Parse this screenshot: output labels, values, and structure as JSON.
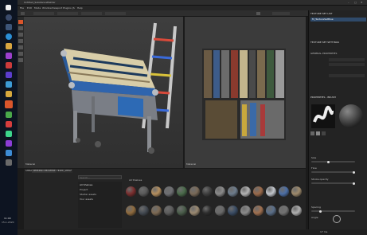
{
  "window": {
    "title": "Untitled_SubstancePainter"
  },
  "menu": [
    "File",
    "Edit",
    "Mode",
    "Window",
    "Viewport",
    "Plugins",
    "JS",
    "Help"
  ],
  "viewport_3d": {
    "label": "Material"
  },
  "viewport_2d": {
    "label": "Material"
  },
  "shelf": {
    "title": "SHELF",
    "tabs": [
      "SPMKRSD MEAMHREL",
      "TEXPE_SHELF"
    ],
    "search_placeholder": "Search...",
    "filter_label": "All Shelves",
    "categories": [
      "All Shelves",
      "Project",
      "Starter assets",
      "Your assets"
    ]
  },
  "materials": [
    {
      "color": "#7a2e2e"
    },
    {
      "color": "#5a5a5a"
    },
    {
      "color": "#b58f5e"
    },
    {
      "color": "#6e6f73"
    },
    {
      "color": "#4a6a4a"
    },
    {
      "color": "#7a6a58"
    },
    {
      "color": "#3f3f3f"
    },
    {
      "color": "#8a8a8a"
    },
    {
      "color": "#6d7c8c"
    },
    {
      "color": "#b4b4b4"
    },
    {
      "color": "#9a6a4a"
    },
    {
      "color": "#c2c6cc"
    },
    {
      "color": "#4c6fa6"
    },
    {
      "color": "#9e8a6c"
    },
    {
      "color": "#8f6b3e"
    },
    {
      "color": "#444a52"
    },
    {
      "color": "#7d6a54"
    },
    {
      "color": "#5c5c5c"
    },
    {
      "color": "#4b5d4b"
    },
    {
      "color": "#9b8a72"
    },
    {
      "color": "#2e2e2e"
    },
    {
      "color": "#6a6a6a"
    },
    {
      "color": "#3a4c64"
    },
    {
      "color": "#8b8b8b"
    },
    {
      "color": "#a07050"
    },
    {
      "color": "#5a6e88"
    },
    {
      "color": "#727272"
    },
    {
      "color": "#b0b0b0"
    }
  ],
  "right_panel": {
    "header": "TEXTURE SET LIST",
    "selected_set": "M_TextureSetBlue",
    "settings_title": "TEXTURE SET SETTINGS",
    "general": "GENERAL PROPERTIES",
    "brush_title": "PROPERTIES - BRUSH",
    "size_label": "Size",
    "flow_label": "Flow",
    "stroke_label": "Stroke opacity",
    "spacing_label": "Spacing",
    "angle_label": "Angle"
  },
  "status": {
    "fps": "17 ms",
    "time": "11:00",
    "date": "15-1-2020"
  }
}
